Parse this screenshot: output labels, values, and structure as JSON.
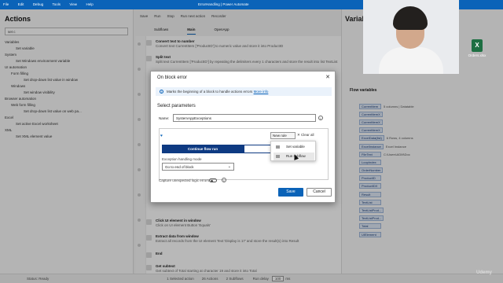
{
  "titlebar": {
    "menu": [
      "File",
      "Edit",
      "Debug",
      "Tools",
      "View",
      "Help"
    ],
    "title": "ErrorHandling | Power Automate"
  },
  "actions_panel": {
    "title": "Actions",
    "search_value": "set c",
    "tree": [
      {
        "level": "grp",
        "label": "Variables"
      },
      {
        "level": "leaf",
        "label": "Set variable"
      },
      {
        "level": "grp",
        "label": "System"
      },
      {
        "level": "leaf",
        "label": "Set Windows environment variable"
      },
      {
        "level": "grp",
        "label": "UI automation"
      },
      {
        "level": "sub",
        "label": "Form filling"
      },
      {
        "level": "leaf2",
        "label": "Set drop-down list value in window"
      },
      {
        "level": "sub",
        "label": "Windows"
      },
      {
        "level": "leaf2",
        "label": "Set window visibility"
      },
      {
        "level": "grp",
        "label": "Browser automation"
      },
      {
        "level": "sub",
        "label": "Web form filling"
      },
      {
        "level": "leaf2",
        "label": "Set drop-down list value on web pa..."
      },
      {
        "level": "grp",
        "label": "Excel"
      },
      {
        "level": "leaf",
        "label": "Set active Excel worksheet"
      },
      {
        "level": "grp",
        "label": "XML"
      },
      {
        "level": "leaf",
        "label": "Set XML element value"
      }
    ]
  },
  "toolbar": {
    "save": "Save",
    "run": "Run",
    "stop": "Stop",
    "run_next": "Run next action",
    "recorder": "Recorder",
    "subflows": "Subflows"
  },
  "tabs": [
    "Main",
    "OpenApp"
  ],
  "canvas_steps": [
    {
      "title": "Convert text to number",
      "desc": "Convert text  CurrentItem ['ProductID'] to numeric value and store it into ProductID"
    },
    {
      "title": "Split text",
      "desc": "Split text  CurrentItem ['ProductID'] by repeating the delimiters every 1 characters and store the result into list TextList"
    },
    {
      "title": "Click UI element in window",
      "desc": "Click on UI element Button 'Equals'"
    },
    {
      "title": "Extract data from window",
      "desc": "Extract all records from the UI element Text 'Display is 17' and store the result(s) into Result"
    },
    {
      "title": "End",
      "desc": ""
    },
    {
      "title": "Get subtext",
      "desc": "Get subtext of  Total  starting at character 19 and store it into  Total"
    }
  ],
  "variables_panel": {
    "title": "Variables",
    "flow_variables_label": "Flow variables",
    "items": [
      {
        "name": "CurrentItem",
        "value": "5 columns | Datatable"
      },
      {
        "name": "CurrentItemX",
        "value": ""
      },
      {
        "name": "CurrentItemX",
        "value": ""
      },
      {
        "name": "CurrentItemX",
        "value": ""
      },
      {
        "name": "ExcelData(list)",
        "value": "6 Rows, 4 columns"
      },
      {
        "name": "ExcelInstance",
        "value": "Excel Instance"
      },
      {
        "name": "FileText",
        "value": "C:\\Users\\ADM\\Doc"
      },
      {
        "name": "LoopIndex",
        "value": ""
      },
      {
        "name": "OrderNumber",
        "value": ""
      },
      {
        "name": "ProductID",
        "value": ""
      },
      {
        "name": "ProductIDX",
        "value": ""
      },
      {
        "name": "Result",
        "value": ""
      },
      {
        "name": "TextList",
        "value": ""
      },
      {
        "name": "TextListProd...",
        "value": ""
      },
      {
        "name": "TextListProd...",
        "value": ""
      },
      {
        "name": "Total",
        "value": ""
      },
      {
        "name": "UIElement",
        "value": ""
      }
    ]
  },
  "desktop_file": {
    "label": "Orders.xlsx",
    "glyph": "X"
  },
  "statusbar": {
    "status": "Status: Ready",
    "selected": "1 Selected action",
    "actions": "26 Actions",
    "subflows": "2 Subflows",
    "run_delay_label": "Run delay",
    "run_delay": "100",
    "unit": "ms"
  },
  "dialog": {
    "title": "On block error",
    "info": "Marks the beginning of a block to handle actions errors",
    "info_link": "More info",
    "select_params": "Select parameters",
    "name_label": "Name:",
    "name_value": "SystemAppExceptions",
    "new_rule": "New rule",
    "clear_all": "Clear all",
    "popup": [
      "Set variable",
      "Run subflow"
    ],
    "continue_flow_run": "Continue flow run",
    "exception_mode_label": "Exception handling mode",
    "exception_mode_value": "Go to end of block",
    "capture_label": "Capture unexpected logic errors",
    "save": "Save",
    "cancel": "Cancel"
  },
  "accent_color": "#0b63b8",
  "watermark": "Udemy"
}
